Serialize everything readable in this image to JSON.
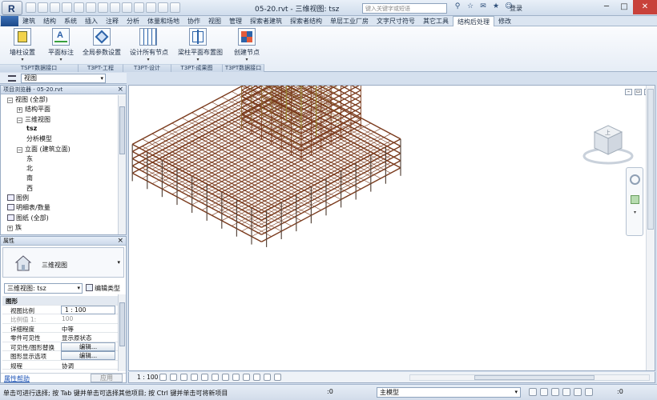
{
  "titlebar": {
    "logo": "R",
    "title": "05-20.rvt - 三维视图: tsz",
    "search_placeholder": "键入关键字或短语",
    "login": "登录",
    "window_buttons": [
      "─",
      "□",
      "✕"
    ]
  },
  "tabs": [
    "建筑",
    "结构",
    "系统",
    "插入",
    "注释",
    "分析",
    "体量和场地",
    "协作",
    "视图",
    "管理",
    "探索者建筑",
    "探索者结构",
    "单层工业厂房",
    "文字尺寸符号",
    "其它工具",
    "结构后处理",
    "修改"
  ],
  "active_tab_index": 15,
  "ribbon": {
    "buttons": [
      {
        "label": "墙柱设置",
        "icon": "wall-column-settings-icon"
      },
      {
        "label": "平面标注",
        "icon": "plan-annotation-icon"
      },
      {
        "label": "全局参数设置",
        "icon": "global-parameters-icon"
      },
      {
        "label": "设计所有节点",
        "icon": "design-nodes-icon"
      },
      {
        "label": "梁柱平面布置图",
        "icon": "beam-column-layout-icon"
      },
      {
        "label": "创建节点",
        "icon": "create-node-icon"
      }
    ],
    "panels": [
      "TSPT数据接口",
      "T3PT-工程",
      "T3PT-设计",
      "T3PT-成果图",
      "T3PT数据接口"
    ]
  },
  "view_selector": {
    "value": "视图"
  },
  "project_browser": {
    "title": "项目浏览器 - 05-20.rvt",
    "items": [
      {
        "label": "视图 (全部)",
        "level": 0,
        "toggle": "−"
      },
      {
        "label": "结构平面",
        "level": 1,
        "toggle": "+"
      },
      {
        "label": "三维视图",
        "level": 1,
        "toggle": "−"
      },
      {
        "label": "tsz",
        "level": 2,
        "toggle": "",
        "bold": true
      },
      {
        "label": "分析模型",
        "level": 2,
        "toggle": ""
      },
      {
        "label": "立面 (建筑立面)",
        "level": 1,
        "toggle": "−"
      },
      {
        "label": "东",
        "level": 2,
        "toggle": ""
      },
      {
        "label": "北",
        "level": 2,
        "toggle": ""
      },
      {
        "label": "南",
        "level": 2,
        "toggle": ""
      },
      {
        "label": "西",
        "level": 2,
        "toggle": ""
      },
      {
        "label": "图例",
        "level": 0,
        "toggle": ""
      },
      {
        "label": "明细表/数量",
        "level": 0,
        "toggle": ""
      },
      {
        "label": "图纸 (全部)",
        "level": 0,
        "toggle": ""
      },
      {
        "label": "族",
        "level": 0,
        "toggle": "+"
      }
    ]
  },
  "properties": {
    "title": "属性",
    "type_name": "三维视图",
    "view_select": "三维视图: tsz",
    "edit_type": "编辑类型",
    "rows": [
      {
        "key": "图形",
        "value": "",
        "kind": "group"
      },
      {
        "key": "视图比例",
        "value": "1 : 100",
        "kind": "box"
      },
      {
        "key": "比例值 1:",
        "value": "100",
        "kind": "dim"
      },
      {
        "key": "详细程度",
        "value": "中等",
        "kind": "text"
      },
      {
        "key": "零件可见性",
        "value": "显示原状态",
        "kind": "text"
      },
      {
        "key": "可见性/图形替换",
        "value": "编辑...",
        "kind": "button"
      },
      {
        "key": "图形显示选项",
        "value": "编辑...",
        "kind": "button"
      },
      {
        "key": "规程",
        "value": "协调",
        "kind": "text"
      }
    ],
    "help": "属性帮助",
    "apply": "应用"
  },
  "viewcube": {
    "face": "上"
  },
  "view_control": {
    "scale": "1 : 100"
  },
  "status": {
    "message": "单击可进行选择; 按 Tab 键并单击可选择其他项目; 按 Ctrl 键并单击可将新项目",
    "selection": ":0",
    "model": "主模型",
    "filter_count": ":0"
  },
  "colors": {
    "accent": "#1d4a8a",
    "rebar": "#7a3a1c",
    "rebar_highlight": "#9c8a3a"
  }
}
